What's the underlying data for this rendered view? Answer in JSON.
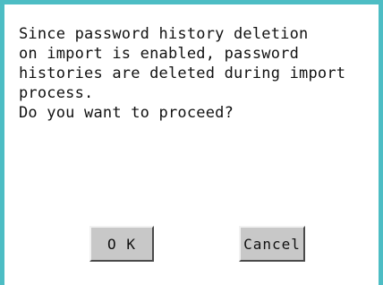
{
  "dialog": {
    "message_lines": [
      "Since password history deletion",
      "on import is enabled, password",
      "histories are deleted during import",
      "process.",
      "Do you want to proceed?"
    ],
    "ok_label": "O K",
    "cancel_label": "Cancel"
  },
  "colors": {
    "border": "#4dbdc4",
    "button_face": "#c8c8c8",
    "background": "#ffffff"
  }
}
